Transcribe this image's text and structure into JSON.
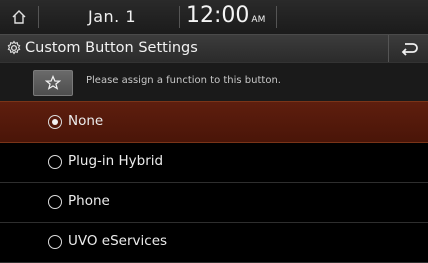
{
  "status": {
    "date": "Jan. 1",
    "time": "12:00",
    "ampm": "AM"
  },
  "header": {
    "title": "Custom Button Settings"
  },
  "prompt": {
    "text": "Please assign a function to this button."
  },
  "options": [
    {
      "label": "None",
      "selected": true
    },
    {
      "label": "Plug-in Hybrid",
      "selected": false
    },
    {
      "label": "Phone",
      "selected": false
    },
    {
      "label": "UVO eServices",
      "selected": false
    }
  ],
  "colors": {
    "selected_bg": "#5e1e0e",
    "background": "#000000"
  }
}
